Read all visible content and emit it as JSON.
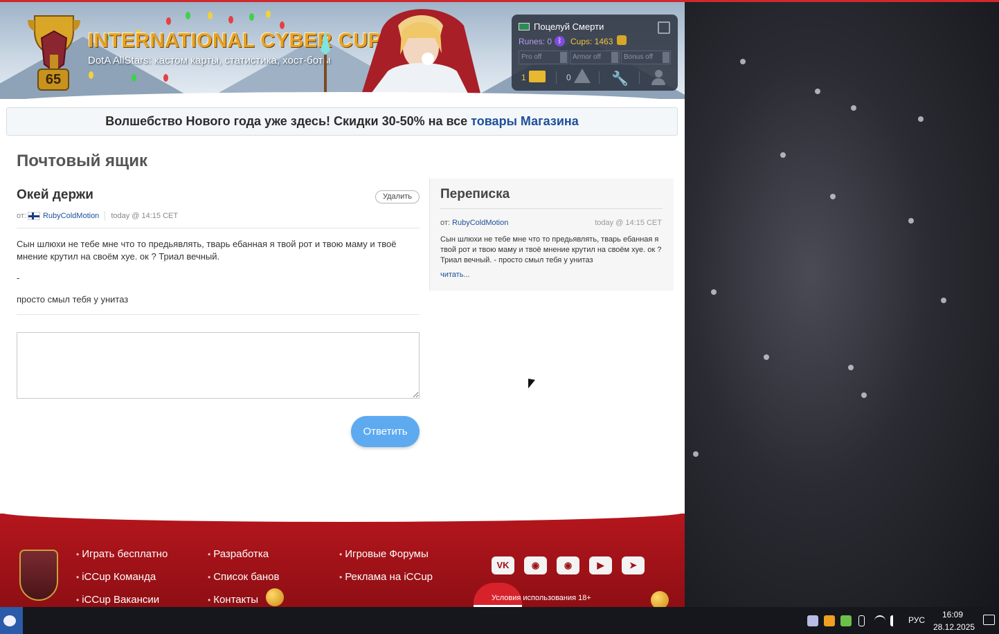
{
  "header": {
    "level": "65",
    "title": "INTERNATIONAL CYBER CUP",
    "subtitle": "DotA AllStars: кастом карты, статистика, хост-боты"
  },
  "user_panel": {
    "username": "Поцелуй Смерти",
    "runes_label": "Runes: 0",
    "cups_label": "Cups: 1463",
    "toggles": [
      "Pro off",
      "Armor off",
      "Bonus off"
    ],
    "mail_count": "1",
    "warn_count": "0"
  },
  "promo": {
    "text": "Волшебство Нового года уже здесь! Скидки 30-50% на все ",
    "link": "товары Магазина"
  },
  "page_title": "Почтовый ящик",
  "message": {
    "subject": "Окей держи",
    "delete_label": "Удалить",
    "from_label": "от:",
    "author": "RubyColdMotion",
    "time": "today @ 14:15 CET",
    "body": [
      "Сын шлюхи не тебе мне что то предьявлять, тварь ебанная я твой рот и твою маму и твоё мнение крутил на своём хуе. ок ? Триал вечный.",
      "-",
      "просто смыл тебя у унитаз"
    ],
    "reply_value": "",
    "reply_label": "Ответить"
  },
  "thread": {
    "title": "Переписка",
    "from_label": "от:",
    "author": "RubyColdMotion",
    "time": "today @ 14:15 CET",
    "snippet": "Сын шлюхи не тебе мне что то предьявлять, тварь ебанная я твой рот и твою маму и твоё мнение крутил на своём хуе. ок ? Триал вечный. - просто смыл тебя у унитаз",
    "read_more": "читать..."
  },
  "footer": {
    "col1": [
      "Играть бесплатно",
      "iCCup Команда",
      "iCCup Вакансии"
    ],
    "col2": [
      "Разработка",
      "Список банов",
      "Контакты"
    ],
    "col3": [
      "Игровые Форумы",
      "Реклама на iCCup"
    ],
    "socials": [
      "vk-icon",
      "discord-icon",
      "discord-icon",
      "youtube-icon",
      "telegram-icon"
    ],
    "terms": "Условия использования 18+"
  },
  "taskbar": {
    "lang": "РУС",
    "time": "16:09",
    "date": "28.12.2025"
  },
  "colors": {
    "brand_red": "#b5161d",
    "link_blue": "#1d4f9a",
    "reply_button": "#5eaaf0"
  }
}
